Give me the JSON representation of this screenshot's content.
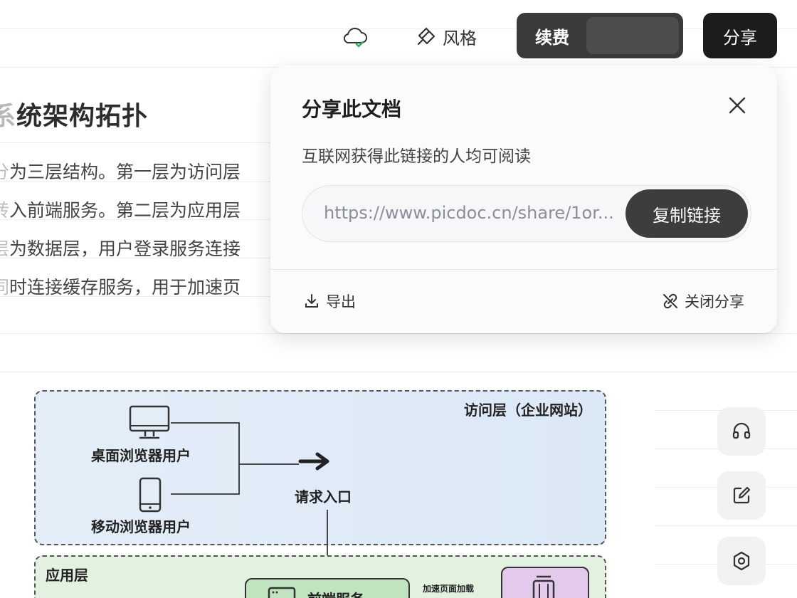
{
  "toolbar": {
    "style_label": "风格",
    "renew_label": "续费",
    "share_label": "分享"
  },
  "document": {
    "title_faded": "系",
    "title": "统架构拓扑",
    "lines": [
      {
        "faded": "分",
        "text": "为三层结构。第一层为访问层"
      },
      {
        "faded": "转",
        "text": "入前端服务。第二层为应用层"
      },
      {
        "faded": "层",
        "text": "为数据层，用户登录服务连接"
      },
      {
        "faded": "同",
        "text": "时连接缓存服务，用于加速页"
      }
    ]
  },
  "share_popover": {
    "title": "分享此文档",
    "description": "互联网获得此链接的人均可阅读",
    "link": "https://www.picdoc.cn/share/1or...",
    "copy_label": "复制链接",
    "export_label": "导出",
    "stop_share_label": "关闭分享"
  },
  "diagram": {
    "access_zone_label": "访问层（企业网站）",
    "desktop_user": "桌面浏览器用户",
    "mobile_user": "移动浏览器用户",
    "entry_label": "请求入口",
    "app_zone_label": "应用层",
    "frontend_label": "前端服务",
    "accelerate_label": "加速页面加载"
  },
  "icons": {
    "cloud": "cloud-synced-icon",
    "style": "paint-bucket-icon",
    "close": "close-icon",
    "export": "download-icon",
    "stop_share": "link-off-icon",
    "headset": "headset-icon",
    "edit": "edit-icon",
    "settings": "settings-icon"
  },
  "colors": {
    "cloud_check": "#2bb24c",
    "dark_button": "#1c1c1c",
    "copy_button": "#3d3d3d"
  }
}
